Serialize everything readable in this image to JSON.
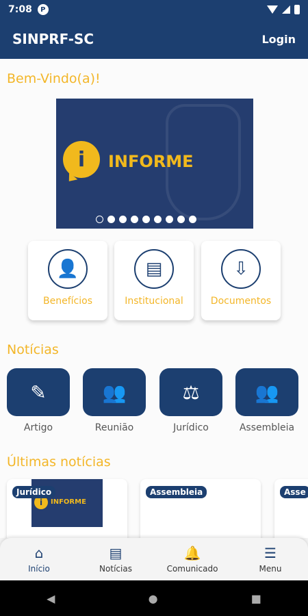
{
  "status": {
    "time": "7:08",
    "badge": "P"
  },
  "app": {
    "title": "SINPRF-SC",
    "login": "Login"
  },
  "welcome": "Bem-Vindo(a)!",
  "banner": {
    "text": "INFORME",
    "icon": "info-icon",
    "dots_count": 9
  },
  "quick_links": [
    {
      "label": "Benefícios",
      "icon": "user-star-icon"
    },
    {
      "label": "Institucional",
      "icon": "document-icon"
    },
    {
      "label": "Documentos",
      "icon": "folder-download-icon"
    }
  ],
  "sections": {
    "noticias": "Notícias",
    "ultimas": "Últimas notícias"
  },
  "news_categories": [
    {
      "label": "Artigo",
      "icon": "edit-document-icon"
    },
    {
      "label": "Reunião",
      "icon": "meeting-icon"
    },
    {
      "label": "Jurídico",
      "icon": "scales-icon"
    },
    {
      "label": "Assembleia",
      "icon": "assembly-icon"
    }
  ],
  "latest_news": [
    {
      "tag": "Jurídico",
      "image_text": "INFORME"
    },
    {
      "tag": "Assembleia"
    },
    {
      "tag": "Asse"
    }
  ],
  "bottom_nav": [
    {
      "label": "Início",
      "icon": "home-icon"
    },
    {
      "label": "Notícias",
      "icon": "news-icon"
    },
    {
      "label": "Comunicado",
      "icon": "bell-icon"
    },
    {
      "label": "Menu",
      "icon": "menu-icon"
    }
  ],
  "colors": {
    "primary": "#1c3f70",
    "accent": "#f3b628"
  }
}
